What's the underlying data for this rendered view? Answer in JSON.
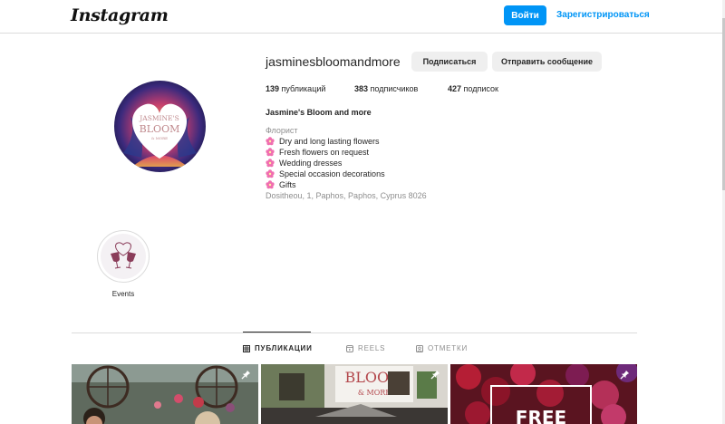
{
  "header": {
    "logo": "Instagram",
    "login_label": "Войти",
    "signup_label": "Зарегистрироваться"
  },
  "profile": {
    "username": "jasminesbloomandmore",
    "follow_label": "Подписаться",
    "message_label": "Отправить сообщение",
    "stats": {
      "posts_count": "139",
      "posts_label": "публикаций",
      "followers_count": "383",
      "followers_label": "подписчиков",
      "following_count": "427",
      "following_label": "подписок"
    },
    "full_name": "Jasmine's Bloom and more",
    "category": "Флорист",
    "bio": [
      "Dry and long lasting flowers",
      "Fresh flowers on request",
      "Wedding dresses",
      "Special occasion decorations",
      "Gifts"
    ],
    "address": "Dositheou, 1, Paphos, Paphos, Cyprus 8026",
    "avatar_text": {
      "line1": "JASMINE'S",
      "line2": "BLOOM",
      "line3": "& MORE"
    }
  },
  "highlights": [
    {
      "label": "Events"
    }
  ],
  "tabs": [
    {
      "label": "ПУБЛИКАЦИИ",
      "icon": "grid-icon",
      "active": true
    },
    {
      "label": "REELS",
      "icon": "reels-icon",
      "active": false
    },
    {
      "label": "ОТМЕТКИ",
      "icon": "tagged-icon",
      "active": false
    }
  ],
  "posts": [
    {
      "pinned": true
    },
    {
      "pinned": true,
      "sign_text": "BLOOM",
      "sign_text2": "& MORE"
    },
    {
      "pinned": true,
      "overlay_text": "FREE"
    }
  ],
  "colors": {
    "accent": "#0095f6",
    "button_grey": "#efefef",
    "text": "#262626",
    "muted": "#8e8e8e",
    "border": "#dbdbdb"
  }
}
